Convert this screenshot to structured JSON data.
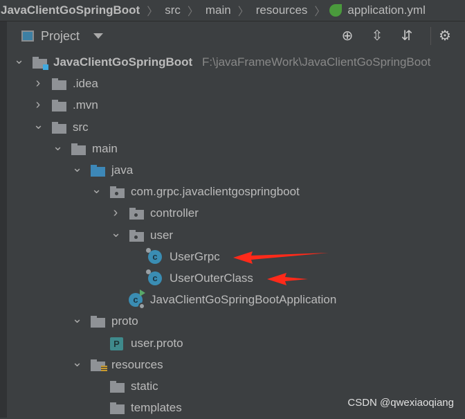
{
  "breadcrumb": [
    "JavaClientGoSpringBoot",
    "src",
    "main",
    "resources",
    "application.yml"
  ],
  "header": {
    "title": "Project",
    "icons": [
      "locate-icon",
      "expand-all-icon",
      "collapse-all-icon",
      "gear-icon"
    ]
  },
  "tree": [
    {
      "label": "JavaClientGoSpringBoot",
      "path": "F:\\javaFrameWork\\JavaClientGoSpringBoot",
      "level": 0,
      "expanded": true,
      "icon": "module-folder",
      "bold": true
    },
    {
      "label": ".idea",
      "level": 1,
      "expanded": false,
      "icon": "folder"
    },
    {
      "label": ".mvn",
      "level": 1,
      "expanded": false,
      "icon": "folder"
    },
    {
      "label": "src",
      "level": 1,
      "expanded": true,
      "icon": "folder"
    },
    {
      "label": "main",
      "level": 2,
      "expanded": true,
      "icon": "folder"
    },
    {
      "label": "java",
      "level": 3,
      "expanded": true,
      "icon": "source-folder"
    },
    {
      "label": "com.grpc.javaclientgospringboot",
      "level": 4,
      "expanded": true,
      "icon": "package"
    },
    {
      "label": "controller",
      "level": 5,
      "expanded": false,
      "icon": "package"
    },
    {
      "label": "user",
      "level": 5,
      "expanded": true,
      "icon": "package"
    },
    {
      "label": "UserGrpc",
      "level": 6,
      "expanded": null,
      "icon": "class-locked",
      "arrow": true
    },
    {
      "label": "UserOuterClass",
      "level": 6,
      "expanded": null,
      "icon": "class-locked",
      "arrow": true
    },
    {
      "label": "JavaClientGoSpringBootApplication",
      "level": 5,
      "expanded": null,
      "icon": "spring-boot-class"
    },
    {
      "label": "proto",
      "level": 3,
      "expanded": true,
      "icon": "folder"
    },
    {
      "label": "user.proto",
      "level": 4,
      "expanded": null,
      "icon": "proto-file"
    },
    {
      "label": "resources",
      "level": 3,
      "expanded": true,
      "icon": "resources-folder"
    },
    {
      "label": "static",
      "level": 4,
      "expanded": null,
      "icon": "folder"
    },
    {
      "label": "templates",
      "level": 4,
      "expanded": null,
      "icon": "folder"
    }
  ],
  "watermark": "CSDN @qwexiaoqiang",
  "colors": {
    "background": "#3c3f41",
    "selection_arrow": "#ff2a1a",
    "class_icon": "#3a8db3"
  }
}
